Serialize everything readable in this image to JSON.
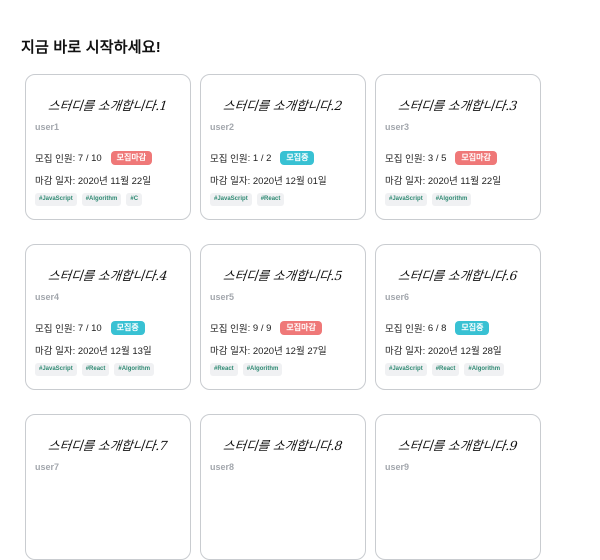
{
  "page": {
    "heading": "지금 바로 시작하세요!"
  },
  "cards": [
    {
      "title": "스터디를 소개합니다.1",
      "user": "user1",
      "members_label": "모집 인원",
      "members": "7 / 10",
      "status": "모집마감",
      "status_type": "closed",
      "deadline_label": "마감 일자",
      "deadline": "2020년 11월 22일",
      "tags": [
        "#JavaScript",
        "#Algorithm",
        "#C"
      ]
    },
    {
      "title": "스터디를 소개합니다.2",
      "user": "user2",
      "members_label": "모집 인원",
      "members": "1 / 2",
      "status": "모집중",
      "status_type": "open",
      "deadline_label": "마감 일자",
      "deadline": "2020년 12월 01일",
      "tags": [
        "#JavaScript",
        "#React"
      ]
    },
    {
      "title": "스터디를 소개합니다.3",
      "user": "user3",
      "members_label": "모집 인원",
      "members": "3 / 5",
      "status": "모집마감",
      "status_type": "closed",
      "deadline_label": "마감 일자",
      "deadline": "2020년 11월 22일",
      "tags": [
        "#JavaScript",
        "#Algorithm"
      ]
    },
    {
      "title": "스터디를 소개합니다.4",
      "user": "user4",
      "members_label": "모집 인원",
      "members": "7 / 10",
      "status": "모집중",
      "status_type": "open",
      "deadline_label": "마감 일자",
      "deadline": "2020년 12월 13일",
      "tags": [
        "#JavaScript",
        "#React",
        "#Algorithm"
      ]
    },
    {
      "title": "스터디를 소개합니다.5",
      "user": "user5",
      "members_label": "모집 인원",
      "members": "9 / 9",
      "status": "모집마감",
      "status_type": "closed",
      "deadline_label": "마감 일자",
      "deadline": "2020년 12월 27일",
      "tags": [
        "#React",
        "#Algorithm"
      ]
    },
    {
      "title": "스터디를 소개합니다.6",
      "user": "user6",
      "members_label": "모집 인원",
      "members": "6 / 8",
      "status": "모집중",
      "status_type": "open",
      "deadline_label": "마감 일자",
      "deadline": "2020년 12월 28일",
      "tags": [
        "#JavaScript",
        "#React",
        "#Algorithm"
      ]
    },
    {
      "title": "스터디를 소개합니다.7",
      "user": "user7"
    },
    {
      "title": "스터디를 소개합니다.8",
      "user": "user8"
    },
    {
      "title": "스터디를 소개합니다.9",
      "user": "user9"
    }
  ],
  "colors": {
    "closed_badge": "#ef7878",
    "open_badge": "#38c1d3",
    "tag_text": "#2f8a73"
  }
}
